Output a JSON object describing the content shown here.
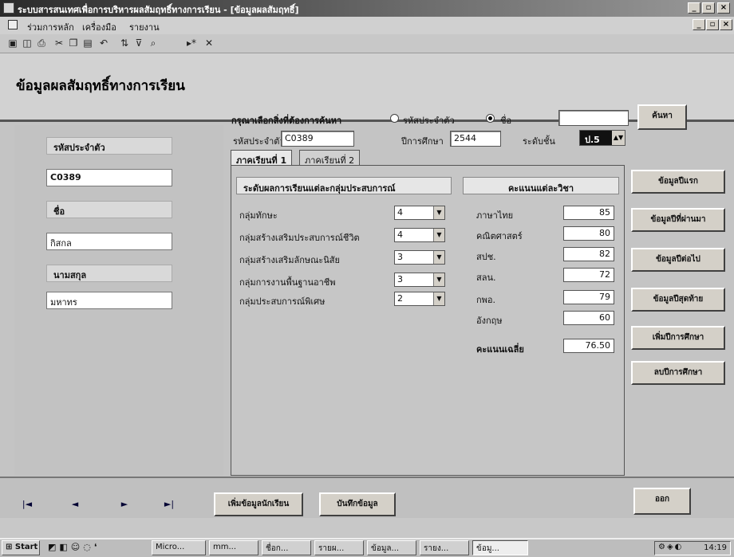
{
  "window": {
    "title": "ระบบสารสนเทศเพื่อการบริหารผลสัมฤทธิ์ทางการเรียน - [ข้อมูลผลสัมฤทธิ์]",
    "min": "_",
    "max": "▫",
    "close": "×"
  },
  "menu": {
    "items": [
      "ร่วมการหลัก",
      "เครื่องมือ",
      "รายงาน"
    ]
  },
  "toolbar": {
    "icons": [
      "save-icon",
      "print-preview-icon",
      "print-icon",
      "cut-icon",
      "copy-icon",
      "paste-icon",
      "undo-icon",
      "sort-icon",
      "filter-icon",
      "find-icon",
      "new-record-icon",
      "delete-record-icon"
    ]
  },
  "form": {
    "title": "ข้อมูลผลสัมฤทธิ์ทางการเรียน",
    "search": {
      "prompt": "กรุณาเลือกสิ่งที่ต้องการค้นหา",
      "option_id": "รหัสประจำตัว",
      "option_name": "ชื่อ",
      "value": "",
      "button": "ค้นหา"
    },
    "left": {
      "id_label": "รหัสประจำตัว",
      "id_value": "C0389",
      "name_label": "ชื่อ",
      "name_value": "กิสกล",
      "surname_label": "นามสกุล",
      "surname_value": "มหาทร"
    },
    "top": {
      "id_label": "รหัสประจำตัว",
      "id_value": "C0389",
      "year_label": "ปีการศึกษา",
      "year_value": "2544",
      "level_label": "ระดับชั้น",
      "level_value": "ป.5"
    },
    "tabs": [
      "ภาคเรียนที่ 1",
      "ภาคเรียนที่ 2"
    ],
    "groups_title": "ระดับผลการเรียนแต่ละกลุ่มประสบการณ์",
    "groups": [
      {
        "label": "กลุ่มทักษะ",
        "value": "4"
      },
      {
        "label": "กลุ่มสร้างเสริมประสบการณ์ชีวิต",
        "value": "4"
      },
      {
        "label": "กลุ่มสร้างเสริมลักษณะนิสัย",
        "value": "3"
      },
      {
        "label": "กลุ่มการงานพื้นฐานอาชีพ",
        "value": "3"
      },
      {
        "label": "กลุ่มประสบการณ์พิเศษ",
        "value": "2"
      }
    ],
    "scores_title": "คะแนนแต่ละวิชา",
    "scores": [
      {
        "label": "ภาษาไทย",
        "value": "85"
      },
      {
        "label": "คณิตศาสตร์",
        "value": "80"
      },
      {
        "label": "สปช.",
        "value": "82"
      },
      {
        "label": "สลน.",
        "value": "72"
      },
      {
        "label": "กพอ.",
        "value": "79"
      },
      {
        "label": "อังกฤษ",
        "value": "60"
      }
    ],
    "avg_label": "คะแนนเฉลี่ย",
    "avg_value": "76.50",
    "right_buttons": [
      "ข้อมูลปีแรก",
      "ข้อมูลปีที่ผ่านมา",
      "ข้อมูลปีต่อไป",
      "ข้อมูลปีสุดท้าย",
      "เพิ่มปีการศึกษา",
      "ลบปีการศึกษา"
    ],
    "nav": {
      "first": "|◄",
      "prev": "◄",
      "next": "►",
      "last": "►|"
    },
    "bottom_buttons": {
      "add_student": "เพิ่มข้อมูลนักเรียน",
      "save": "บันทึกข้อมูล",
      "exit": "ออก"
    }
  },
  "taskbar": {
    "start": "Start",
    "tasks": [
      "Micro...",
      "mm...",
      "ชื่อก...",
      "รายผ...",
      "ข้อมูล...",
      "รายง...",
      "ข้อมู..."
    ],
    "clock": "14:19"
  }
}
